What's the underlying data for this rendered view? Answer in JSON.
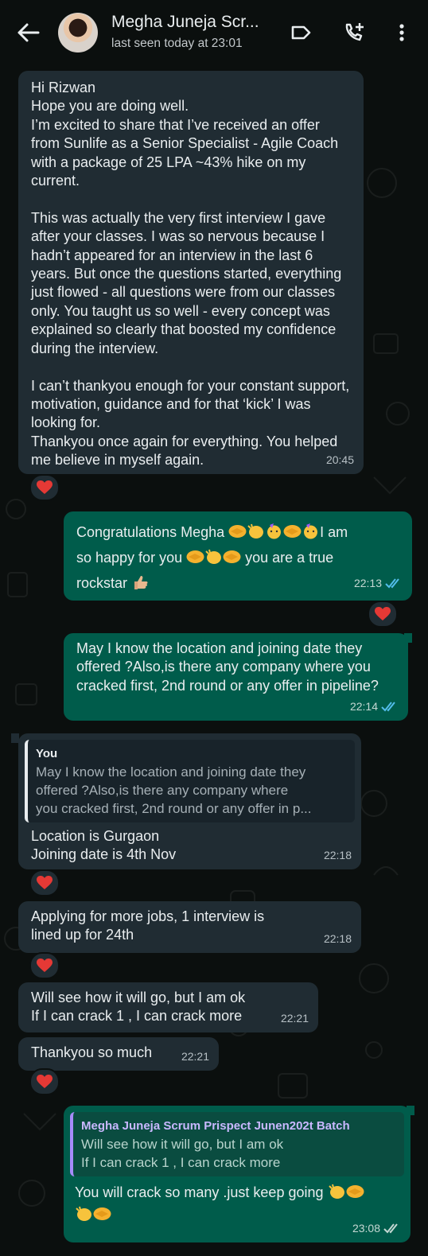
{
  "header": {
    "title": "Megha Juneja Scr...",
    "status": "last seen today at 23:01"
  },
  "messages": [
    {
      "text": "Hi Rizwan\nHope you are doing well.\nI’m excited to share that I’ve received an offer from Sunlife as a Senior Specialist - Agile Coach with a package of 25 LPA ~43% hike on my current.\n\nThis was actually the very first interview I gave after your classes. I was so nervous because I hadn’t appeared for an interview in the last 6 years. But once the questions started, everything just flowed - all questions were from our classes only. You taught us so well - every concept was explained so clearly that boosted my confidence during the interview.\n\nI can’t thankyou enough for your constant support, motivation, guidance and for that ‘kick’ I was looking for.\nThankyou once again for everything. You helped me believe in myself again.",
      "time": "20:45"
    },
    {
      "line1": "Congratulations Megha",
      "line1b": "I am",
      "line2a": "so happy for you",
      "line2b": "you are a true",
      "line3": "rockstar",
      "time": "22:13"
    },
    {
      "text": "May I know the location and joining date they offered ?Also,is there any company where you cracked first, 2nd round or any offer in pipeline?",
      "time": "22:14"
    },
    {
      "quote_name": "You",
      "quote_text": "May I know the location and joining date they\noffered ?Also,is there any company where\nyou cracked first, 2nd round or any offer in p...",
      "text": "Location is Gurgaon\nJoining date is 4th Nov",
      "time": "22:18"
    },
    {
      "text": "Applying for more jobs, 1 interview is lined up for 24th",
      "time": "22:18"
    },
    {
      "text": "Will see how it will go, but I am ok\nIf I can crack 1 , I can crack more",
      "time": "22:21"
    },
    {
      "text": "Thankyou so much",
      "time": "22:21"
    },
    {
      "quote_name": "Megha Juneja Scrum Prispect Junen202t Batch",
      "quote_text": "Will see how it will go, but I am ok\nIf I can crack 1 , I can crack more",
      "text": "You will crack so many .just keep going",
      "time": "23:08"
    }
  ],
  "icons": {
    "back": "arrow-left-icon",
    "label": "label-icon",
    "call": "add-call-icon",
    "menu": "more-vert-icon",
    "reaction": "red-heart-icon",
    "read": "double-check-icon"
  },
  "colors": {
    "incoming": "#202c33",
    "outgoing": "#005c4b",
    "read_tick": "#53bdeb",
    "heart": "#e53935"
  }
}
